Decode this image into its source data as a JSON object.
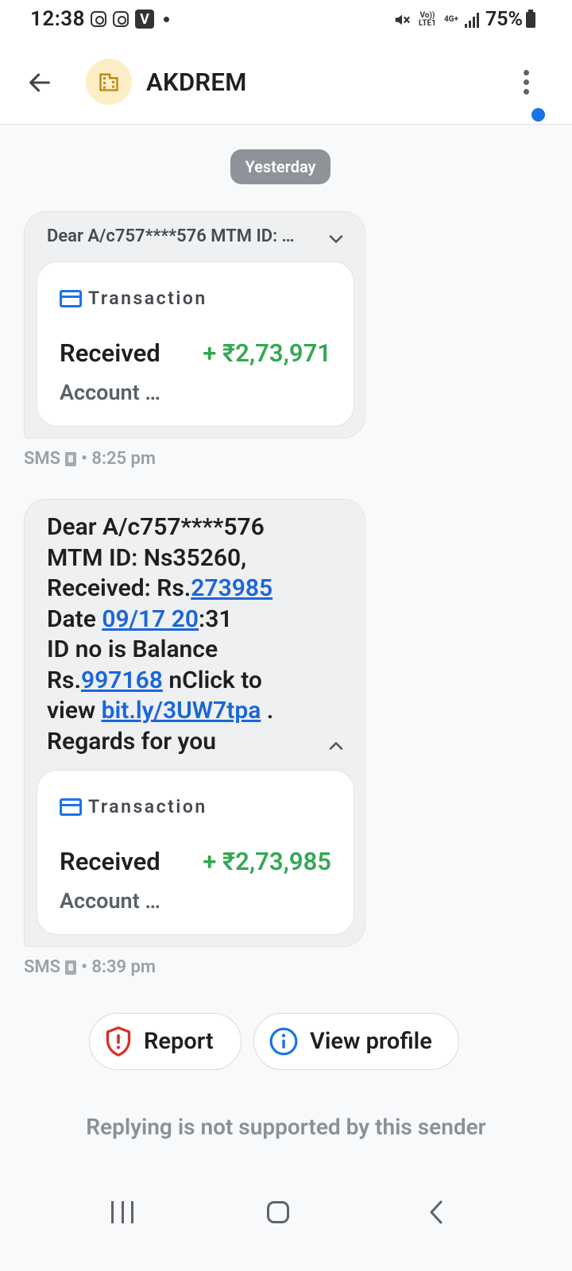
{
  "status_bar": {
    "time": "12:38",
    "left_icons": [
      "instagram-icon",
      "instagram-icon",
      "vpn-v-icon",
      "dot-icon"
    ],
    "v_icon_text": "V",
    "network_top": "Vo)) LTE1",
    "network_gen": "4G+",
    "battery": "75%"
  },
  "app_bar": {
    "sender": "AKDREM",
    "avatar_icon": "building-icon",
    "avatar_bg": "#fcefc5",
    "badge_color": "#1a73e8"
  },
  "conversation": {
    "date_chip": "Yesterday",
    "messages": [
      {
        "collapsed_preview": "Dear A/c757****576 MTM ID: …",
        "card": {
          "title": "Transaction",
          "status": "Received",
          "amount": "+ ₹2,73,971",
          "subtitle": "Account …"
        },
        "channel": "SMS",
        "time": "• 8:25 pm"
      },
      {
        "body_lines": [
          [
            "Dear A/c757****576"
          ],
          [
            "MTM ID: Ns35260,"
          ],
          [
            "Received: Rs.",
            {
              "link": "273985"
            }
          ],
          [
            "Date ",
            {
              "link": "09/17 20"
            },
            ":31"
          ],
          [
            "ID no is Balance"
          ],
          [
            "Rs.",
            {
              "link": "997168"
            },
            " nClick to"
          ],
          [
            "view ",
            {
              "link": "bit.ly/3UW7tpa"
            },
            " ."
          ],
          [
            "Regards for you"
          ]
        ],
        "card": {
          "title": "Transaction",
          "status": "Received",
          "amount": "+ ₹2,73,985",
          "subtitle": "Account …"
        },
        "channel": "SMS",
        "time": "• 8:39 pm"
      }
    ]
  },
  "actions": {
    "report": "Report",
    "view_profile": "View profile"
  },
  "reply_note": "Replying is not supported by this sender",
  "colors": {
    "accent": "#1a73e8",
    "amount_green": "#34a853",
    "report_red": "#d93025",
    "link_blue": "#1a66d9"
  }
}
